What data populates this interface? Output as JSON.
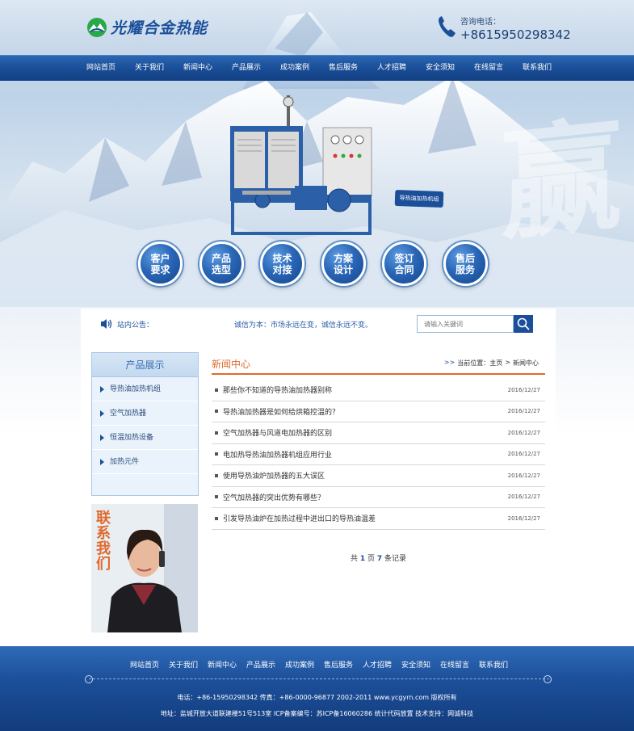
{
  "header": {
    "brand": "光耀合金热能",
    "phone_label": "咨询电话：",
    "phone_number": "+8615950298342"
  },
  "nav": [
    "网站首页",
    "关于我们",
    "新闻中心",
    "产品展示",
    "成功案例",
    "售后服务",
    "人才招聘",
    "安全须知",
    "在线留言",
    "联系我们"
  ],
  "banner": {
    "product_tag": "导热油加热机组",
    "circles": [
      "客户\n要求",
      "产品\n选型",
      "技术\n对接",
      "方案\n设计",
      "签订\n合同",
      "售后\n服务"
    ]
  },
  "notice": {
    "label": "站内公告：",
    "text": "诚信为本：市场永远在变，诚信永远不变。",
    "search_placeholder": "请输入关键词"
  },
  "sidebar": {
    "title": "产品展示",
    "items": [
      "导热油加热机组",
      "空气加热器",
      "恒温加热设备",
      "加热元件"
    ]
  },
  "contact_image_text": "联系我们",
  "news": {
    "title": "新闻中心",
    "breadcrumb_label": "当前位置：",
    "breadcrumb_home": "主页",
    "breadcrumb_sep": ">",
    "breadcrumb_current": "新闻中心",
    "items": [
      {
        "title": "那些你不知道的导热油加热器别称",
        "date": "2016/12/27"
      },
      {
        "title": "导热油加热器是如何给烘箱控温的？",
        "date": "2016/12/27"
      },
      {
        "title": "空气加热器与风道电加热器的区别",
        "date": "2016/12/27"
      },
      {
        "title": "电加热导热油加热器机组应用行业",
        "date": "2016/12/27"
      },
      {
        "title": "使用导热油炉加热器的五大误区",
        "date": "2016/12/27"
      },
      {
        "title": "空气加热器的突出优势有哪些？",
        "date": "2016/12/27"
      },
      {
        "title": "引发导热油炉在加热过程中进出口的导热油温差",
        "date": "2016/12/27"
      }
    ],
    "pager": {
      "prefix": "共",
      "page": "1",
      "mid": "页",
      "count": "7",
      "suffix": "条记录"
    }
  },
  "footer": {
    "nav": [
      "网站首页",
      "关于我们",
      "新闻中心",
      "产品展示",
      "成功案例",
      "售后服务",
      "人才招聘",
      "安全须知",
      "在线留言",
      "联系我们"
    ],
    "info1": "电话：+86-15950298342   传真：+86-0000-96877   2002-2011 www.ycgyrn.com 版权所有",
    "info2": "地址：盐城开放大道联建楼51号513室   ICP备案编号：苏ICP备16060286   统计代码放置   技术支持：网诚科技"
  },
  "colors": {
    "brand_blue": "#1c4f9a",
    "accent_orange": "#e06a2e"
  }
}
